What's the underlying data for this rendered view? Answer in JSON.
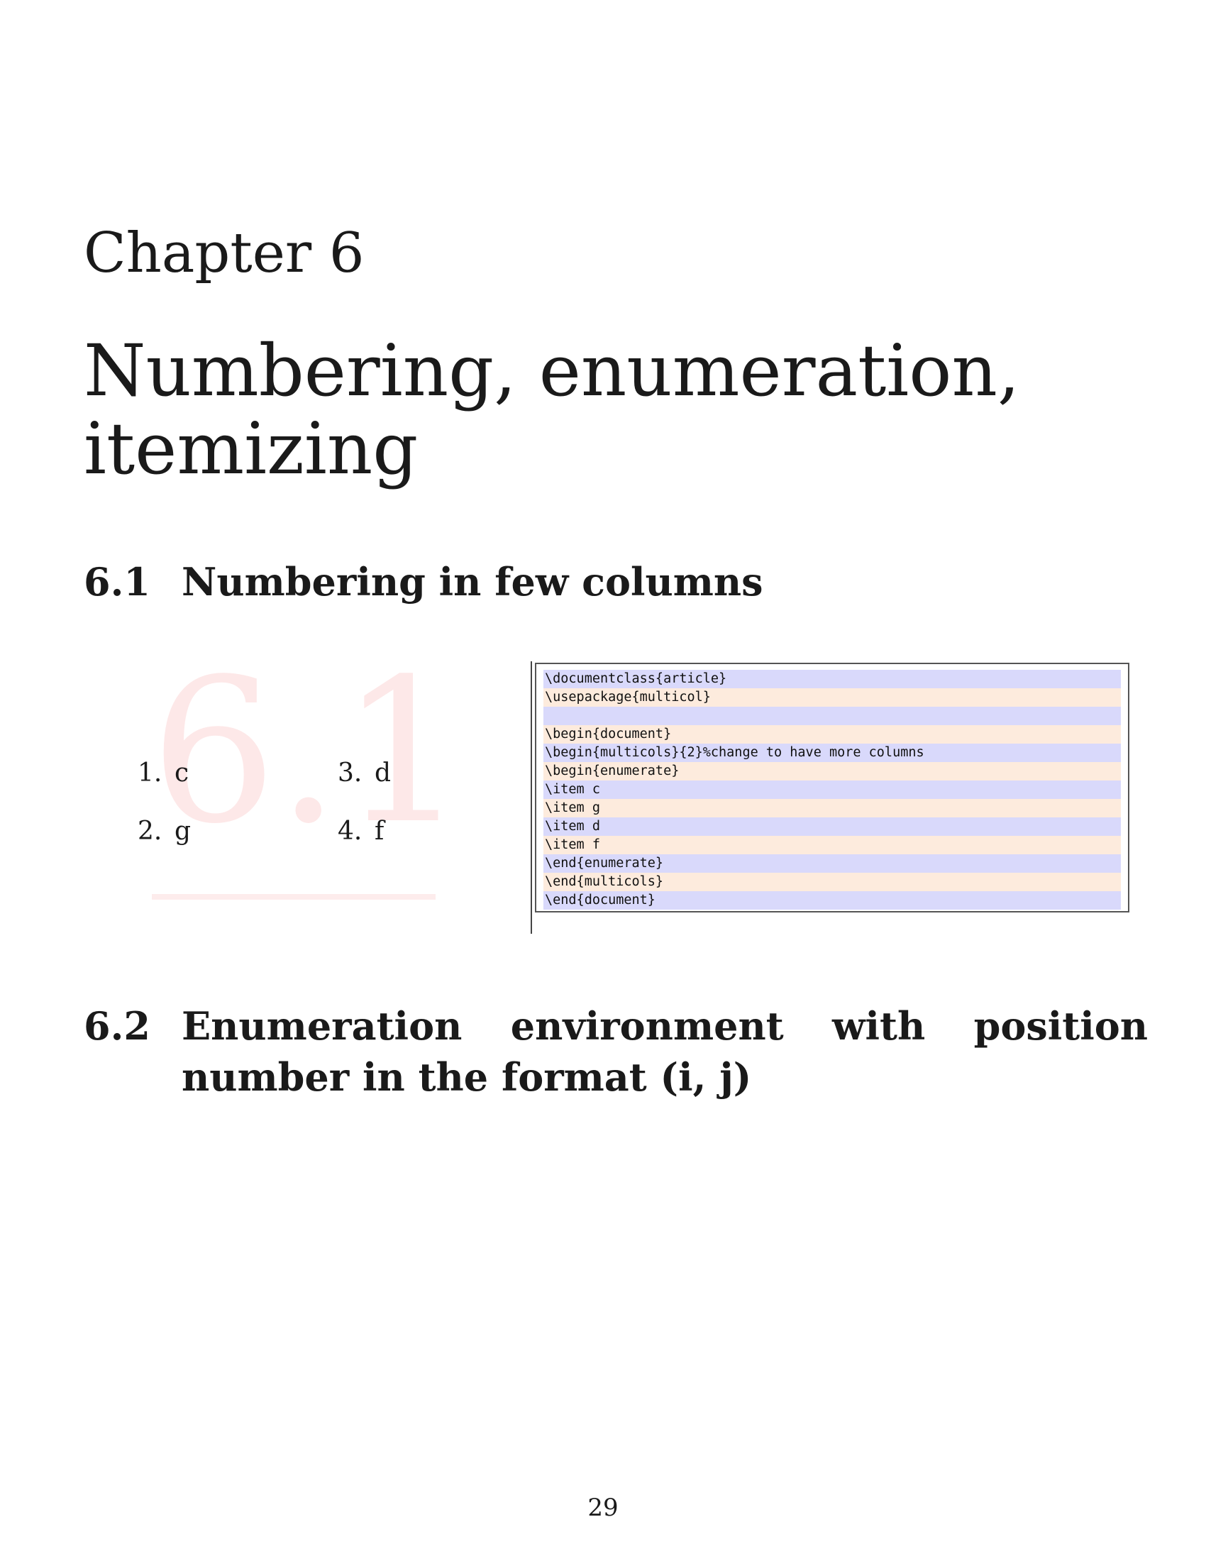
{
  "chapter": {
    "label": "Chapter 6",
    "title": "Numbering, enumeration, itemizing"
  },
  "sections": [
    {
      "number": "6.1",
      "title": "Numbering in few columns",
      "watermark": "6.1",
      "example_output": {
        "items": [
          {
            "marker": "1.",
            "text": "c"
          },
          {
            "marker": "2.",
            "text": "g"
          },
          {
            "marker": "3.",
            "text": "d"
          },
          {
            "marker": "4.",
            "text": "f"
          }
        ]
      },
      "code_lines": [
        "\\documentclass{article}",
        "\\usepackage{multicol}",
        "",
        "\\begin{document}",
        "\\begin{multicols}{2}%change to have more columns",
        "\\begin{enumerate}",
        "\\item c",
        "\\item g",
        "\\item d",
        "\\item f",
        "\\end{enumerate}",
        "\\end{multicols}",
        "\\end{document}"
      ]
    },
    {
      "number": "6.2",
      "title": "Enumeration environment with position number in the format (i, j)"
    }
  ],
  "page_number": "29",
  "colors": {
    "code_odd_row": "#d9d9fb",
    "code_even_row": "#fdebdd",
    "watermark": "#fde8e8"
  }
}
